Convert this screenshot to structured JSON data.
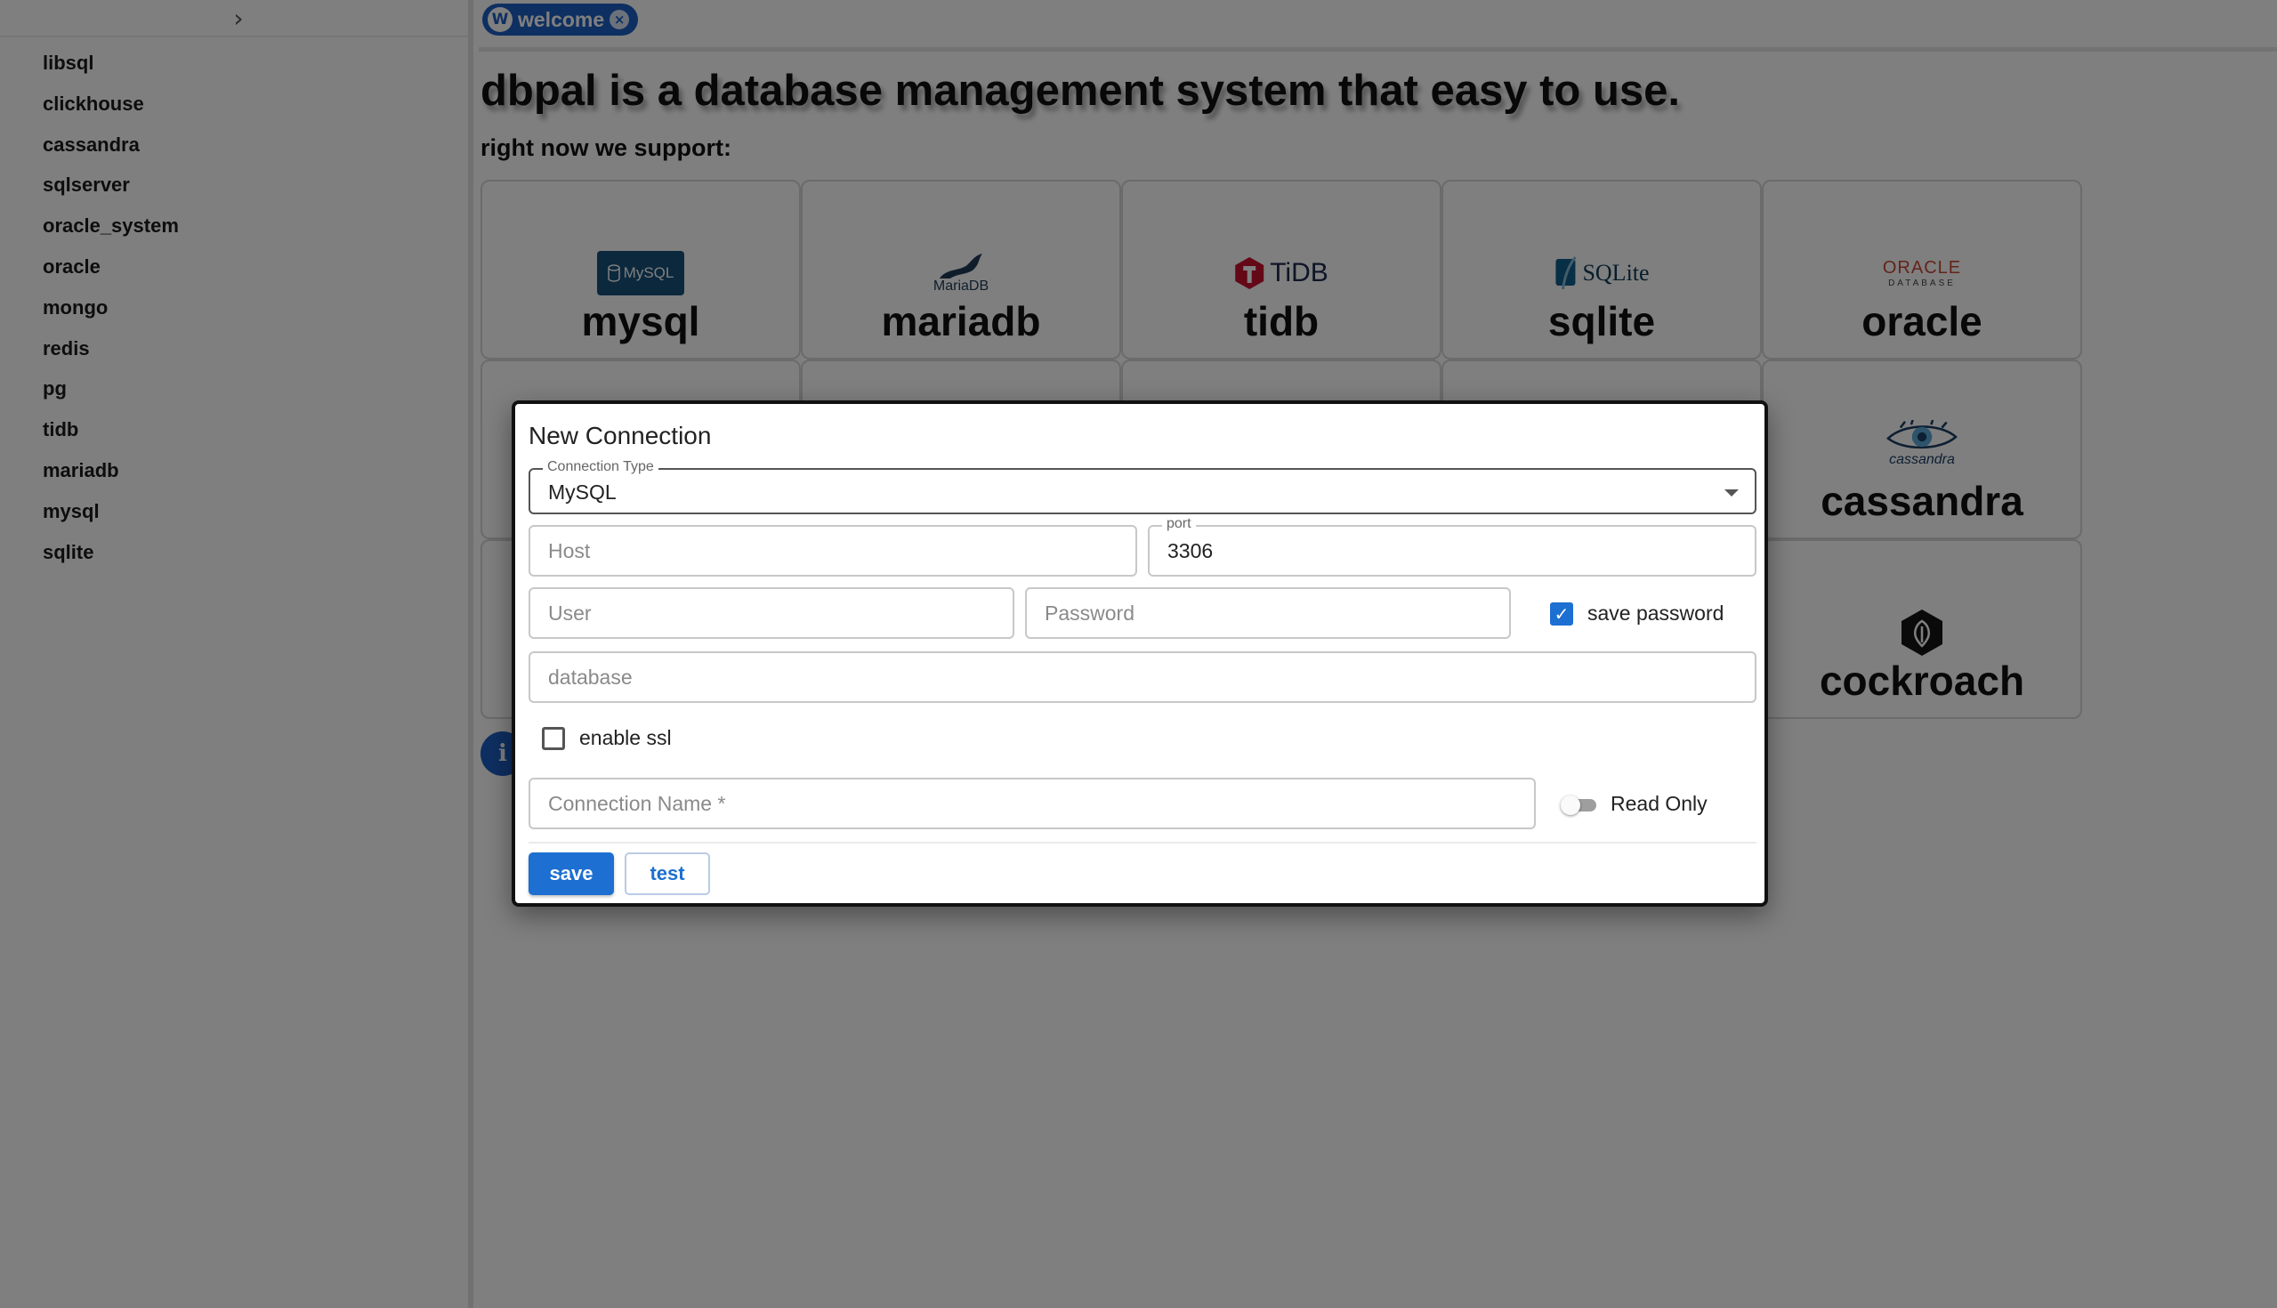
{
  "sidebar": {
    "toggle_icon": "chevron-right-icon",
    "toggle_glyph": "›",
    "items": [
      "libsql",
      "clickhouse",
      "cassandra",
      "sqlserver",
      "oracle_system",
      "oracle",
      "mongo",
      "redis",
      "pg",
      "tidb",
      "mariadb",
      "mysql",
      "sqlite"
    ]
  },
  "tab": {
    "label": "welcome",
    "logo_glyph": "W",
    "close_glyph": "×"
  },
  "main": {
    "headline": "dbpal is a database management system that easy to use.",
    "subhead": "right now we support:",
    "cards": [
      {
        "name": "mysql",
        "logo_text": "MySQL"
      },
      {
        "name": "mariadb",
        "logo_text": "MariaDB"
      },
      {
        "name": "tidb",
        "logo_text": "TiDB"
      },
      {
        "name": "sqlite",
        "logo_text": "SQLite"
      },
      {
        "name": "oracle",
        "logo_text": "ORACLE",
        "logo_sub": "DATABASE"
      },
      {
        "name": "",
        "logo_text": ""
      },
      {
        "name": "",
        "logo_text": ""
      },
      {
        "name": "",
        "logo_text": ""
      },
      {
        "name": "",
        "logo_text": ""
      },
      {
        "name": "cassandra",
        "logo_text": "cassandra"
      },
      {
        "name": "",
        "logo_text": ""
      },
      {
        "name": "",
        "logo_text": ""
      },
      {
        "name": "",
        "logo_text": ""
      },
      {
        "name": "",
        "logo_text": ""
      },
      {
        "name": "cockroach",
        "logo_text": ""
      }
    ],
    "info_glyph": "i"
  },
  "dialog": {
    "title": "New Connection",
    "connection_type": {
      "label": "Connection Type",
      "value": "MySQL"
    },
    "host": {
      "placeholder": "Host",
      "value": ""
    },
    "port": {
      "label": "port",
      "value": "3306"
    },
    "user": {
      "placeholder": "User",
      "value": ""
    },
    "password": {
      "placeholder": "Password",
      "value": ""
    },
    "save_password": {
      "label": "save password",
      "checked": true,
      "check_glyph": "✓"
    },
    "database": {
      "placeholder": "database",
      "value": ""
    },
    "enable_ssl": {
      "label": "enable ssl",
      "checked": false
    },
    "connection_name": {
      "placeholder": "Connection Name *",
      "value": ""
    },
    "read_only": {
      "label": "Read Only",
      "on": false
    },
    "save_label": "save",
    "test_label": "test"
  },
  "colors": {
    "accent": "#1d6fd1",
    "tab_bg": "#1d5ec2",
    "overlay": "rgba(0,0,0,0.5)"
  }
}
